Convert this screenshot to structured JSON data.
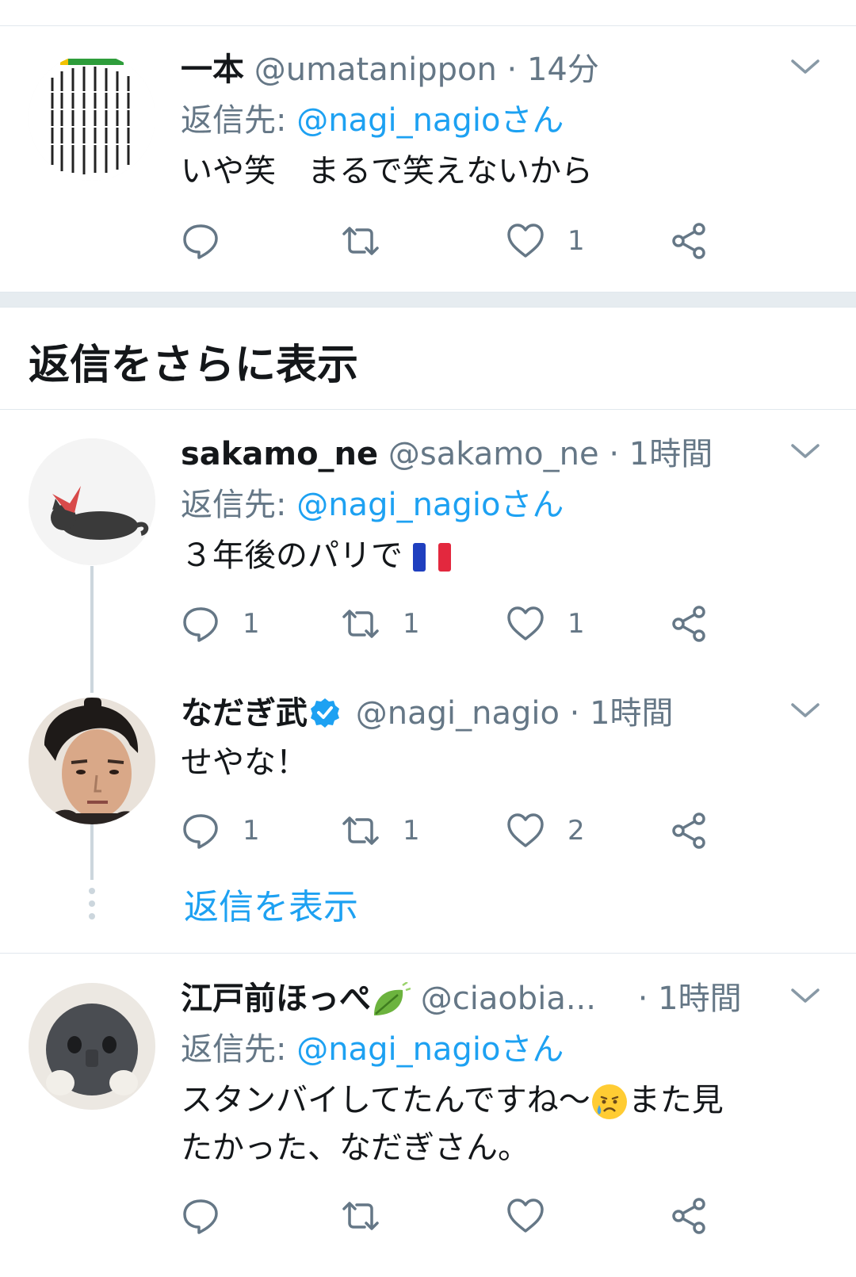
{
  "colors": {
    "accent": "#1da1f2",
    "secondary_text": "#657786",
    "primary_text": "#14171a",
    "divider": "#e1e8ed"
  },
  "tweets": [
    {
      "display_name": "一本",
      "handle": "@umatanippon",
      "separator": "·",
      "time": "14分",
      "reply_prefix": "返信先: ",
      "reply_mention": "@nagi_nagioさん",
      "text": "いや笑　まるで笑えないから",
      "reply_count": "",
      "retweet_count": "",
      "like_count": "1",
      "avatar_icon": "text-collage-avatar"
    },
    {
      "display_name": "sakamo_ne",
      "handle": "@sakamo_ne",
      "separator": "·",
      "time": "1時間",
      "reply_prefix": "返信先: ",
      "reply_mention": "@nagi_nagioさん",
      "text": "３年後のパリで",
      "reply_count": "1",
      "retweet_count": "1",
      "like_count": "1",
      "text_emoji": "france-flag-icon",
      "avatar_icon": "sleeping-cat-avatar"
    },
    {
      "display_name": "なだぎ武",
      "handle": "@nagi_nagio",
      "separator": "·",
      "time": "1時間",
      "text": "せやな！",
      "reply_count": "1",
      "retweet_count": "1",
      "like_count": "2",
      "verified": true,
      "avatar_icon": "portrait-avatar"
    },
    {
      "display_name": "江戸前ほっぺ",
      "handle": "@ciaobia...",
      "separator": "·",
      "time": "1時間",
      "reply_prefix": "返信先: ",
      "reply_mention": "@nagi_nagioさん",
      "text_line1_a": "スタンバイしてたんですね〜",
      "text_line1_b": "また見",
      "text_line2": "たかった、なだぎさん。",
      "reply_count": "",
      "retweet_count": "",
      "like_count": "",
      "name_emoji": "leaf-icon",
      "text_emoji": "crying-face-icon",
      "avatar_icon": "plush-face-avatar"
    }
  ],
  "more_replies_heading": "返信をさらに表示",
  "show_replies_link": "返信を表示"
}
